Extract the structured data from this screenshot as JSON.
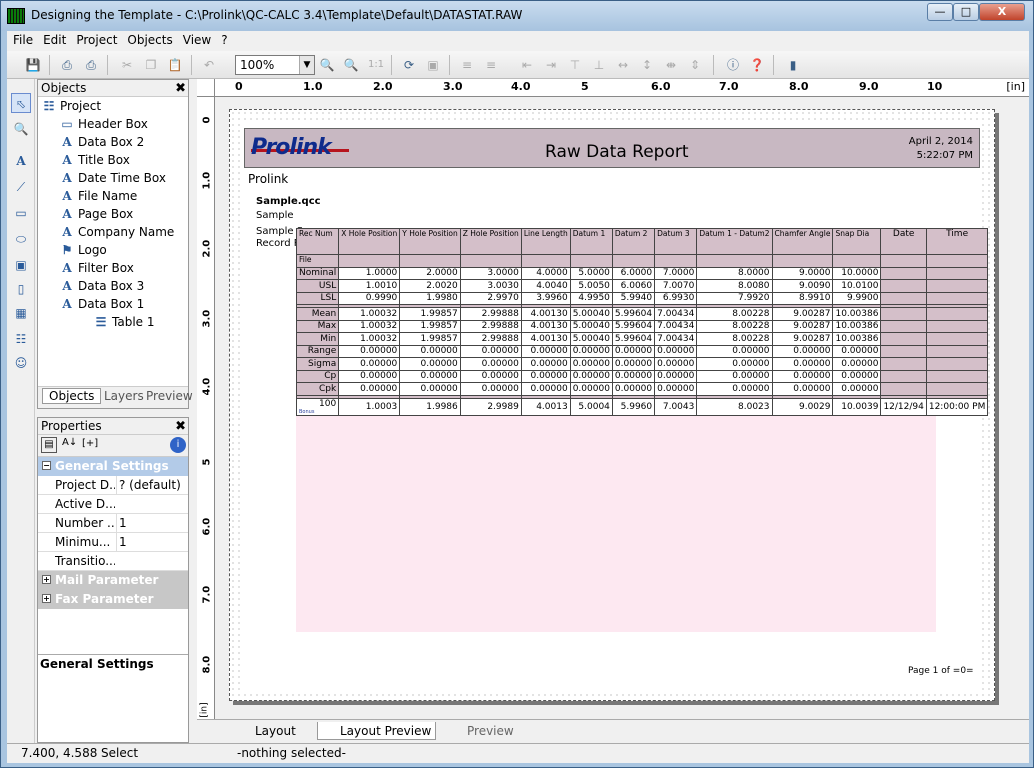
{
  "window": {
    "title": "Designing the Template - C:\\Prolink\\QC-CALC 3.4\\Template\\Default\\DATASTAT.RAW",
    "minimize": "—",
    "restore": "□",
    "close": "X"
  },
  "menu": [
    "File",
    "Edit",
    "Project",
    "Objects",
    "View",
    "?"
  ],
  "toolbar": {
    "zoom": "100%",
    "zoom_1to1": "1:1"
  },
  "objects_panel": {
    "title": "Objects",
    "items": [
      {
        "label": "Project",
        "icon": "document-icon",
        "indent": 0
      },
      {
        "label": "Header Box",
        "icon": "header-box-icon",
        "indent": 1
      },
      {
        "label": "Data Box 2",
        "icon": "text-a-icon",
        "indent": 1
      },
      {
        "label": "Title Box",
        "icon": "text-a-icon",
        "indent": 1
      },
      {
        "label": "Date Time Box",
        "icon": "text-a-icon",
        "indent": 1
      },
      {
        "label": "File Name",
        "icon": "text-a-icon",
        "indent": 1
      },
      {
        "label": "Page Box",
        "icon": "text-a-icon",
        "indent": 1
      },
      {
        "label": "Company Name",
        "icon": "text-a-icon",
        "indent": 1
      },
      {
        "label": "Logo",
        "icon": "image-icon",
        "indent": 1
      },
      {
        "label": "Filter Box",
        "icon": "text-a-icon",
        "indent": 1
      },
      {
        "label": "Data Box 3",
        "icon": "text-a-icon",
        "indent": 1
      },
      {
        "label": "Data Box 1",
        "icon": "text-a-icon",
        "indent": 1
      },
      {
        "label": "Table 1",
        "icon": "table-icon",
        "indent": 2
      }
    ],
    "tabs": [
      "Objects",
      "Layers",
      "Preview"
    ]
  },
  "properties_panel": {
    "title": "Properties",
    "groups": [
      {
        "name": "General Settings",
        "expanded": true,
        "rows": [
          {
            "key": "Project D...",
            "value": "? (default)"
          },
          {
            "key": "Active D...",
            "value": ""
          },
          {
            "key": "Number ...",
            "value": "1"
          },
          {
            "key": "Minimu...",
            "value": "1"
          },
          {
            "key": "Transitio...",
            "value": ""
          }
        ]
      },
      {
        "name": "Mail Parameter",
        "expanded": false,
        "rows": []
      },
      {
        "name": "Fax Parameter",
        "expanded": false,
        "rows": []
      }
    ],
    "description_title": "General Settings"
  },
  "ruler": {
    "unit": "[in]",
    "h_labels": [
      "0",
      "1.0",
      "2.0",
      "3.0",
      "4.0",
      "5",
      "6.0",
      "7.0",
      "8.0",
      "9.0",
      "10"
    ],
    "v_labels": [
      "0",
      "1.0",
      "2.0",
      "3.0",
      "4.0",
      "5",
      "6.0",
      "7.0",
      "8.0"
    ]
  },
  "report": {
    "title": "Raw Data Report",
    "date": "April 2, 2014",
    "time": "5:22:07 PM",
    "company": "Prolink",
    "logo_text": "Prolink",
    "meta": [
      "Sample.qcc",
      "Sample",
      "Sample S",
      "Record R"
    ],
    "columns": [
      "Rec Num",
      "X Hole Position",
      "Y Hole Position",
      "Z Hole Position",
      "Line Length",
      "Datum 1",
      "Datum 2",
      "Datum 3",
      "Datum 1 - Datum2",
      "Chamfer Angle",
      "Snap Dia",
      "Date",
      "Time"
    ],
    "file_label": "File",
    "spec_rows": [
      {
        "label": "Nominal",
        "values": [
          "1.0000",
          "2.0000",
          "3.0000",
          "4.0000",
          "5.0000",
          "6.0000",
          "7.0000",
          "8.0000",
          "9.0000",
          "10.0000"
        ]
      },
      {
        "label": "USL",
        "values": [
          "1.0010",
          "2.0020",
          "3.0030",
          "4.0040",
          "5.0050",
          "6.0060",
          "7.0070",
          "8.0080",
          "9.0090",
          "10.0100"
        ]
      },
      {
        "label": "LSL",
        "values": [
          "0.9990",
          "1.9980",
          "2.9970",
          "3.9960",
          "4.9950",
          "5.9940",
          "6.9930",
          "7.9920",
          "8.9910",
          "9.9900"
        ]
      }
    ],
    "stat_rows": [
      {
        "label": "Mean",
        "values": [
          "1.00032",
          "1.99857",
          "2.99888",
          "4.00130",
          "5.00040",
          "5.99604",
          "7.00434",
          "8.00228",
          "9.00287",
          "10.00386"
        ]
      },
      {
        "label": "Max",
        "values": [
          "1.00032",
          "1.99857",
          "2.99888",
          "4.00130",
          "5.00040",
          "5.99604",
          "7.00434",
          "8.00228",
          "9.00287",
          "10.00386"
        ]
      },
      {
        "label": "Min",
        "values": [
          "1.00032",
          "1.99857",
          "2.99888",
          "4.00130",
          "5.00040",
          "5.99604",
          "7.00434",
          "8.00228",
          "9.00287",
          "10.00386"
        ]
      },
      {
        "label": "Range",
        "values": [
          "0.00000",
          "0.00000",
          "0.00000",
          "0.00000",
          "0.00000",
          "0.00000",
          "0.00000",
          "0.00000",
          "0.00000",
          "0.00000"
        ]
      },
      {
        "label": "Sigma",
        "values": [
          "0.00000",
          "0.00000",
          "0.00000",
          "0.00000",
          "0.00000",
          "0.00000",
          "0.00000",
          "0.00000",
          "0.00000",
          "0.00000"
        ]
      },
      {
        "label": "Cp",
        "values": [
          "0.00000",
          "0.00000",
          "0.00000",
          "0.00000",
          "0.00000",
          "0.00000",
          "0.00000",
          "0.00000",
          "0.00000",
          "0.00000"
        ]
      },
      {
        "label": "Cpk",
        "values": [
          "0.00000",
          "0.00000",
          "0.00000",
          "0.00000",
          "0.00000",
          "0.00000",
          "0.00000",
          "0.00000",
          "0.00000",
          "0.00000"
        ]
      }
    ],
    "data_rows": [
      {
        "label": "100",
        "sub": "Bonus",
        "values": [
          "1.0003",
          "1.9986",
          "2.9989",
          "4.0013",
          "5.0004",
          "5.9960",
          "7.0043",
          "8.0023",
          "9.0029",
          "10.0039"
        ],
        "date": "12/12/94",
        "time": "12:00:00 PM"
      }
    ],
    "page_text": "Page 1 of =0="
  },
  "bottom_tabs": [
    "Layout",
    "Layout Preview",
    "Preview"
  ],
  "status": {
    "coords": "7.400, 4.588",
    "mode": "Select",
    "message": "-nothing selected-"
  }
}
